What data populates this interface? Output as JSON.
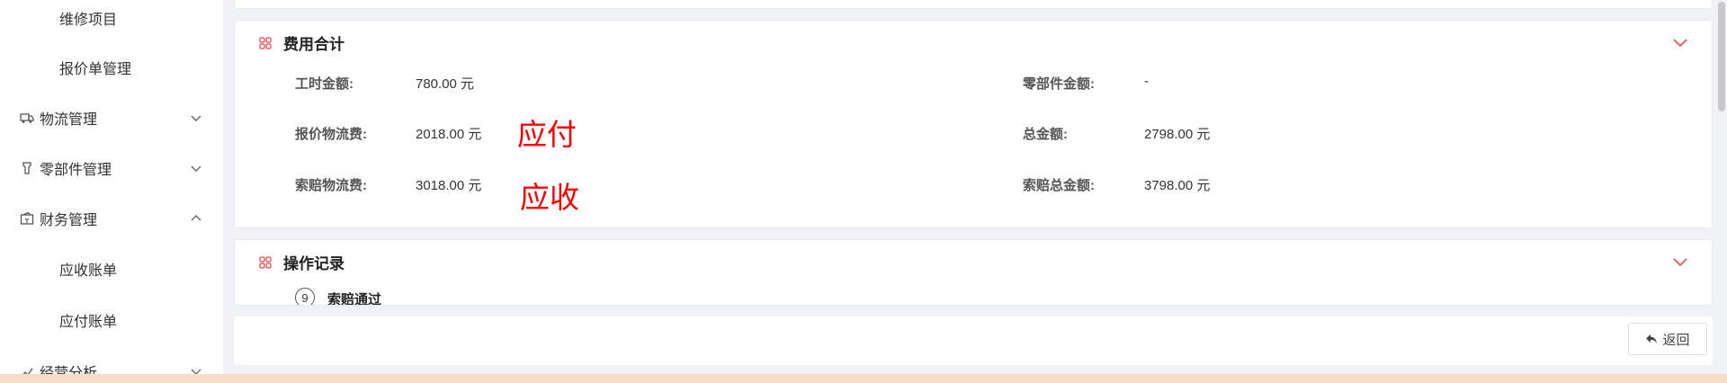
{
  "sidebar": {
    "items": [
      {
        "label": "维修项目"
      },
      {
        "label": "报价单管理"
      },
      {
        "label": "物流管理"
      },
      {
        "label": "零部件管理"
      },
      {
        "label": "财务管理"
      },
      {
        "label": "应收账单"
      },
      {
        "label": "应付账单"
      },
      {
        "label": "经营分析"
      }
    ]
  },
  "fee_card": {
    "title": "费用合计",
    "labor_label": "工时金额:",
    "labor_value": "780.00 元",
    "parts_label": "零部件金额:",
    "parts_value": "-",
    "quote_logistics_label": "报价物流费:",
    "quote_logistics_value": "2018.00 元",
    "total_label": "总金额:",
    "total_value": "2798.00 元",
    "claim_logistics_label": "索赔物流费:",
    "claim_logistics_value": "3018.00 元",
    "claim_total_label": "索赔总金额:",
    "claim_total_value": "3798.00 元",
    "annotation_payable": "应付",
    "annotation_receivable": "应收"
  },
  "ops_card": {
    "title": "操作记录",
    "step_number": "9",
    "step_title": "索赔通过"
  },
  "footer": {
    "back_label": "返回"
  },
  "colors": {
    "accent_icon": "#e84a4a",
    "annotation": "#ff0000",
    "background": "#f0f2f5"
  }
}
